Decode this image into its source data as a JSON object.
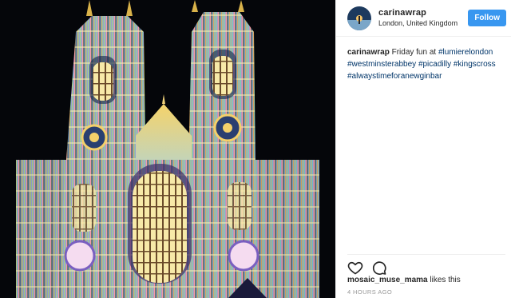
{
  "post": {
    "username": "carinawrap",
    "location": "London, United Kingdom",
    "follow_label": "Follow",
    "caption_username": "carinawrap",
    "caption_text": "Friday fun at",
    "hashtags": [
      "#lumierelondon",
      "#westminsterabbey",
      "#picadilly",
      "#kingscross",
      "#alwaystimeforanewginbar"
    ],
    "liked_by": "mosaic_muse_mama",
    "likes_suffix": "likes this",
    "timestamp": "4 HOURS AGO"
  },
  "icons": {
    "like": "heart-icon",
    "comment": "comment-icon"
  },
  "colors": {
    "follow_button": "#3897f0",
    "hashtag": "#003569",
    "muted": "#999999"
  }
}
